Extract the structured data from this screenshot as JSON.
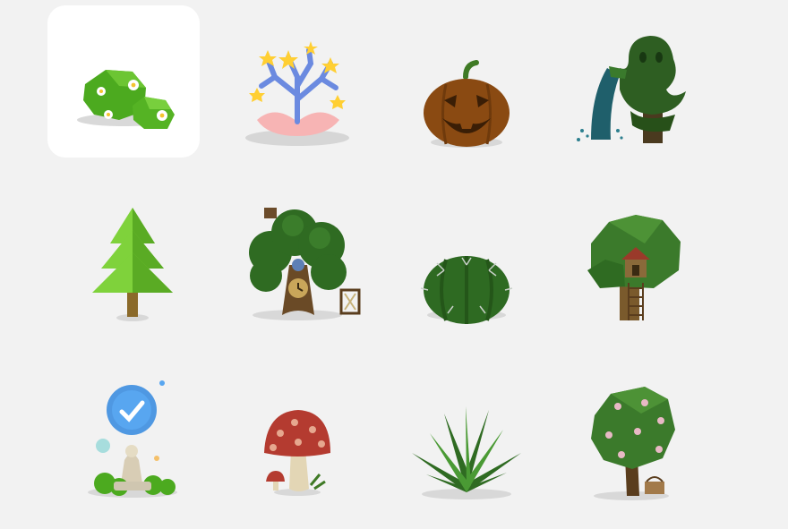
{
  "selected_index": 0,
  "items": [
    {
      "icon": "flowering-bush-icon"
    },
    {
      "icon": "coral-flower-icon"
    },
    {
      "icon": "jack-o-lantern-icon"
    },
    {
      "icon": "ghost-tree-icon"
    },
    {
      "icon": "pine-tree-icon"
    },
    {
      "icon": "clock-tree-icon"
    },
    {
      "icon": "barrel-cactus-icon"
    },
    {
      "icon": "treehouse-tree-icon"
    },
    {
      "icon": "achievement-statue-icon"
    },
    {
      "icon": "mushroom-icon"
    },
    {
      "icon": "agave-plant-icon"
    },
    {
      "icon": "blossom-tree-picnic-icon"
    }
  ],
  "colors": {
    "background": "#f2f2f2",
    "selected_tile": "#ffffff"
  }
}
